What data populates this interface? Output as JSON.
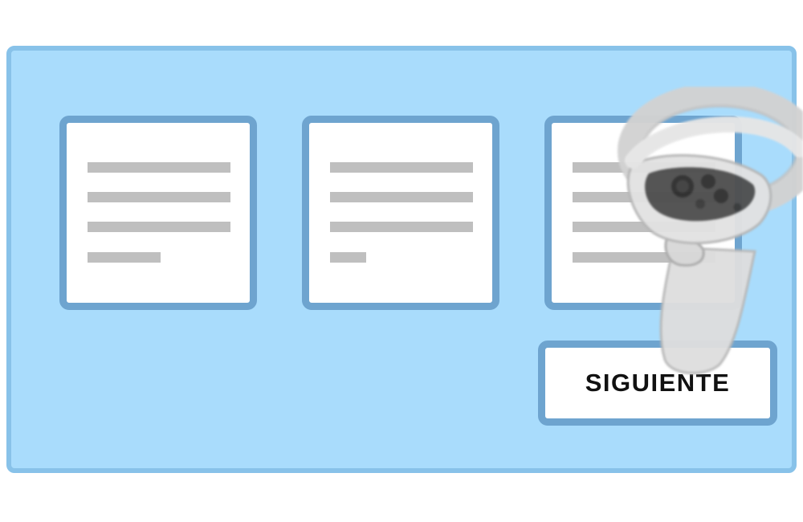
{
  "next_button": {
    "label": "SIGUIENTE"
  },
  "cards": [
    {
      "name": "card-1",
      "text_lines": 4
    },
    {
      "name": "card-2",
      "text_lines": 4
    },
    {
      "name": "card-3",
      "text_lines": 4
    }
  ],
  "colors": {
    "panel_background": "#a9dcfc",
    "panel_border": "#88c2e9",
    "card_border": "#6ea4cf",
    "placeholder_line": "#bfbfbf",
    "controller_body": "#dedede"
  },
  "icons": {
    "controller": "vr-controller-icon"
  }
}
